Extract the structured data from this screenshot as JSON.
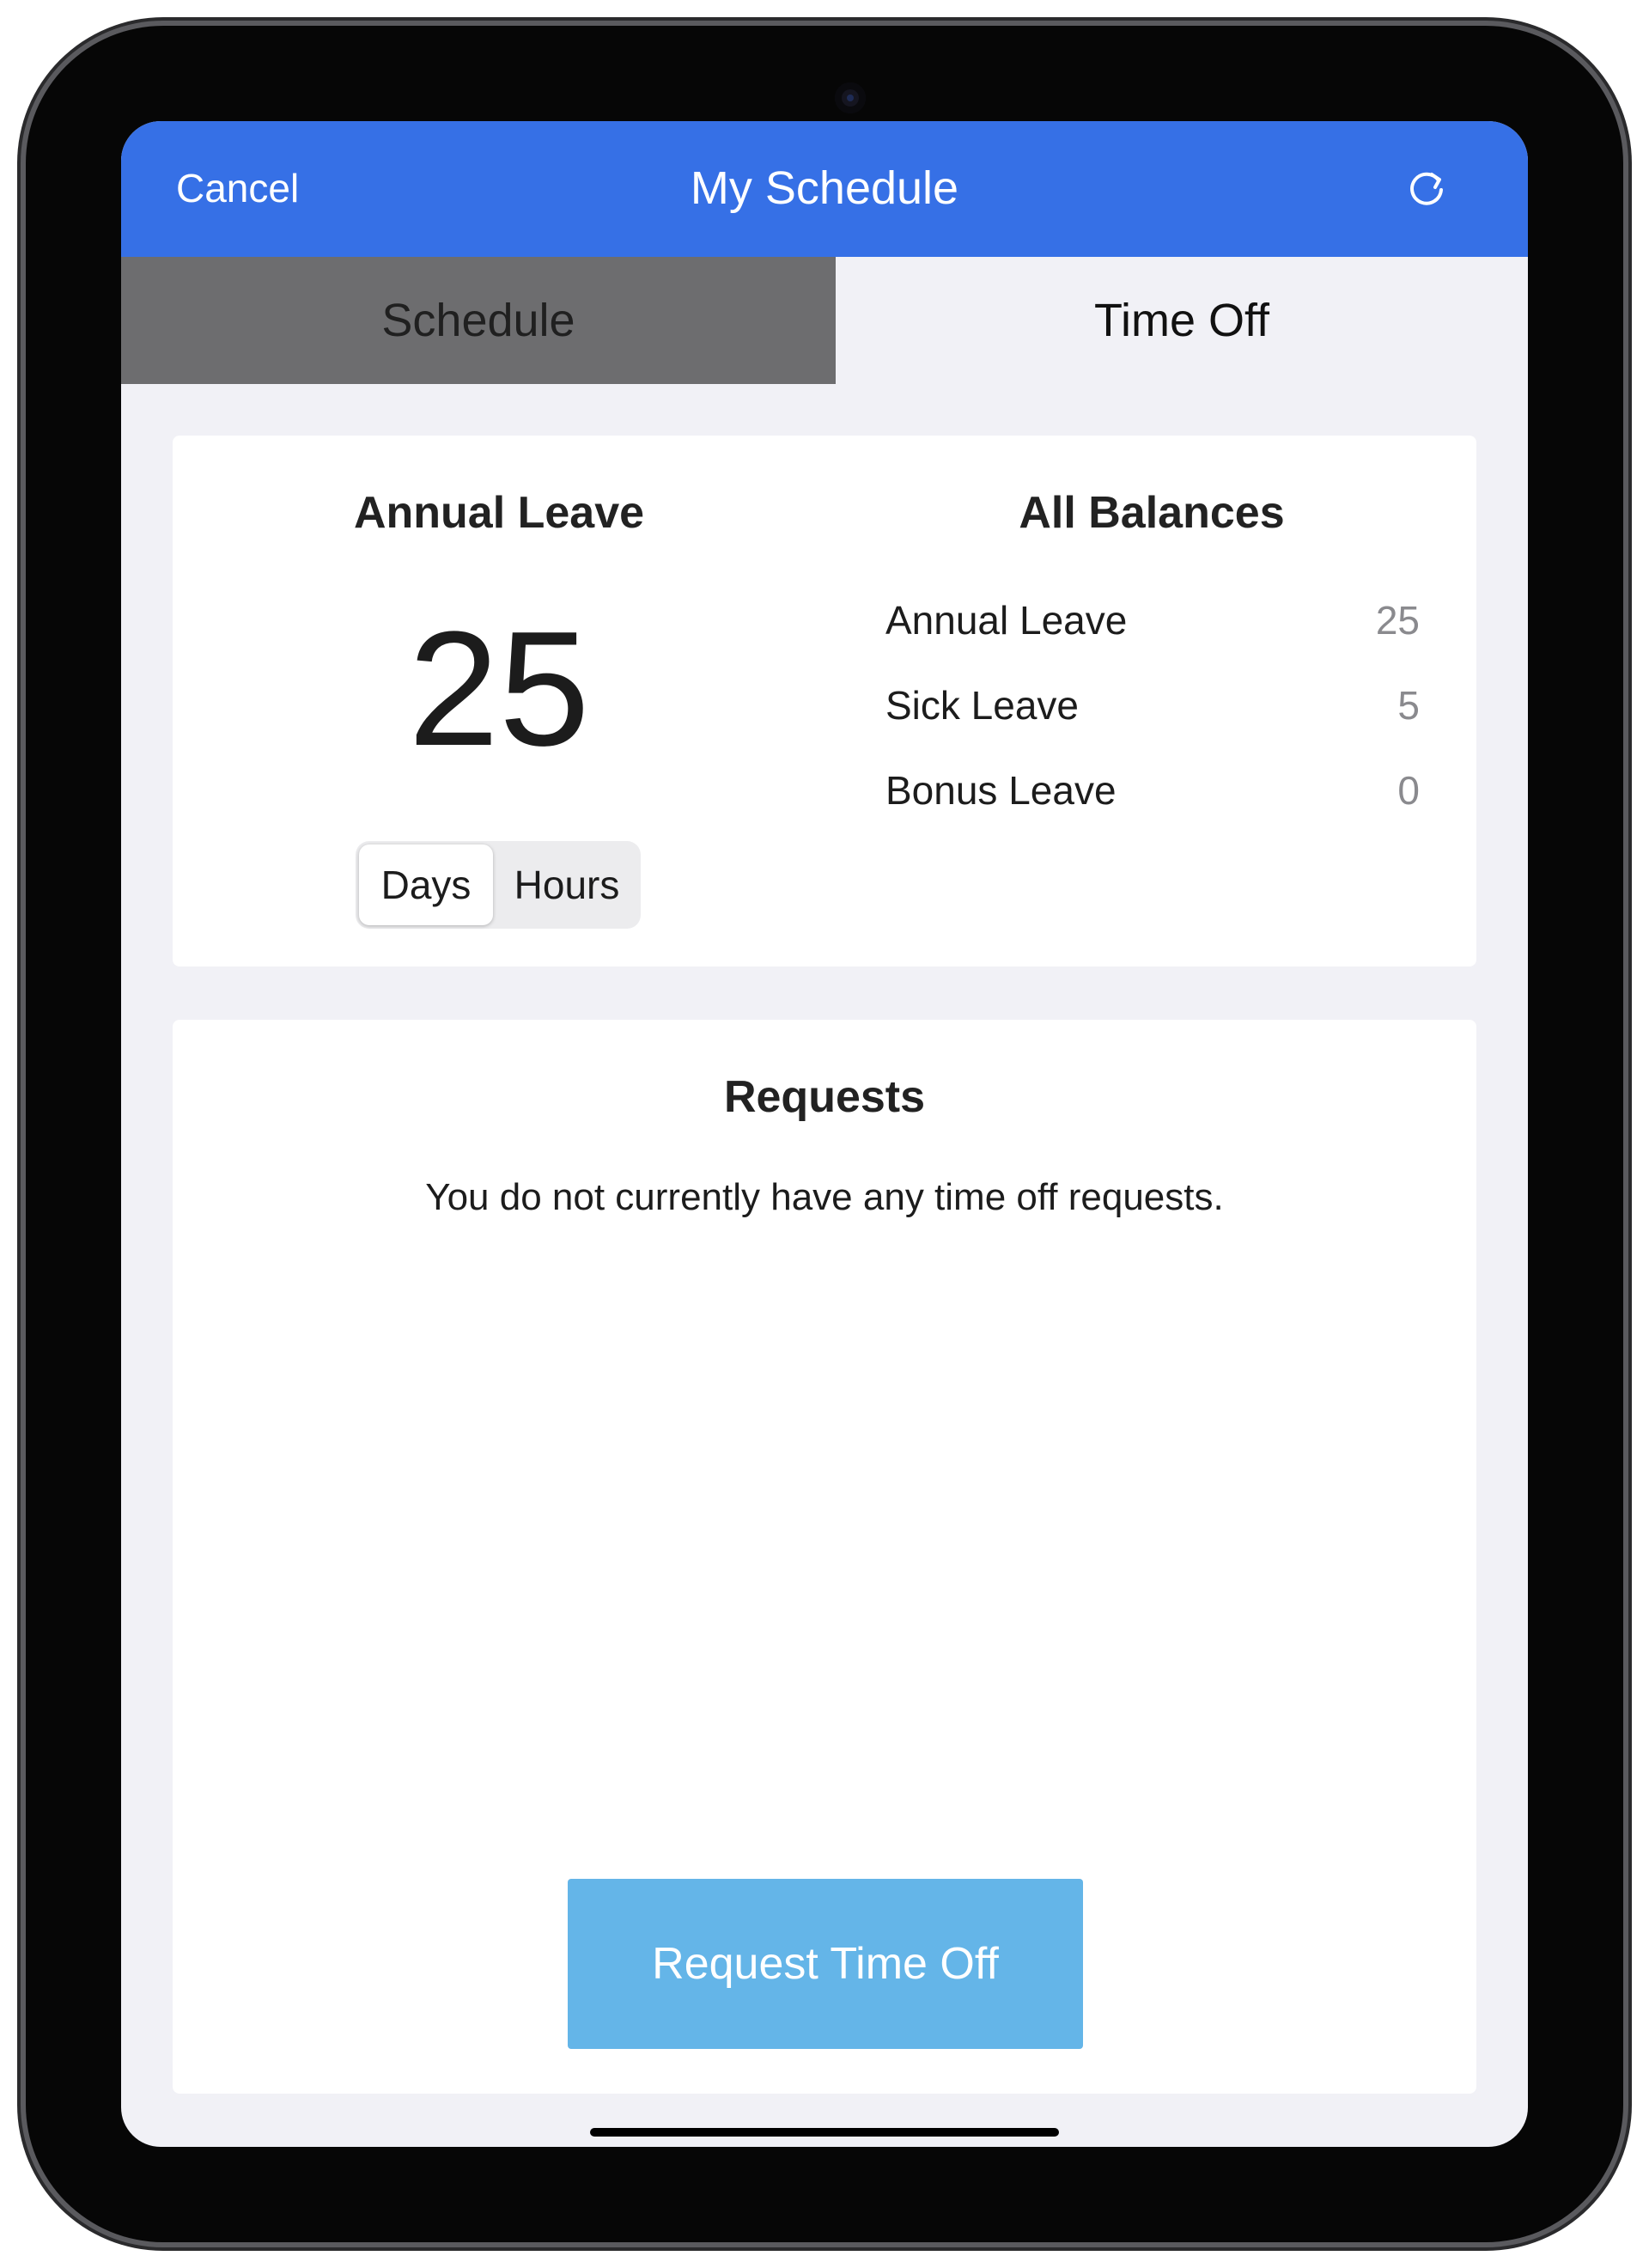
{
  "navbar": {
    "cancel_label": "Cancel",
    "title": "My Schedule",
    "refresh_icon": "refresh-icon",
    "background_color": "#3670e6"
  },
  "tabs": [
    {
      "label": "Schedule",
      "active": false
    },
    {
      "label": "Time Off",
      "active": true
    }
  ],
  "balance_card": {
    "selected_title": "Annual Leave",
    "selected_value": "25",
    "unit_toggle": {
      "options": [
        "Days",
        "Hours"
      ],
      "selected": "Days"
    },
    "all_balances_title": "All Balances",
    "balances": [
      {
        "name": "Annual Leave",
        "value": "25"
      },
      {
        "name": "Sick Leave",
        "value": "5"
      },
      {
        "name": "Bonus Leave",
        "value": "0"
      }
    ]
  },
  "requests_card": {
    "title": "Requests",
    "empty_message": "You do not currently have any time off requests.",
    "button_label": "Request Time Off",
    "button_color": "#64b5e8"
  }
}
